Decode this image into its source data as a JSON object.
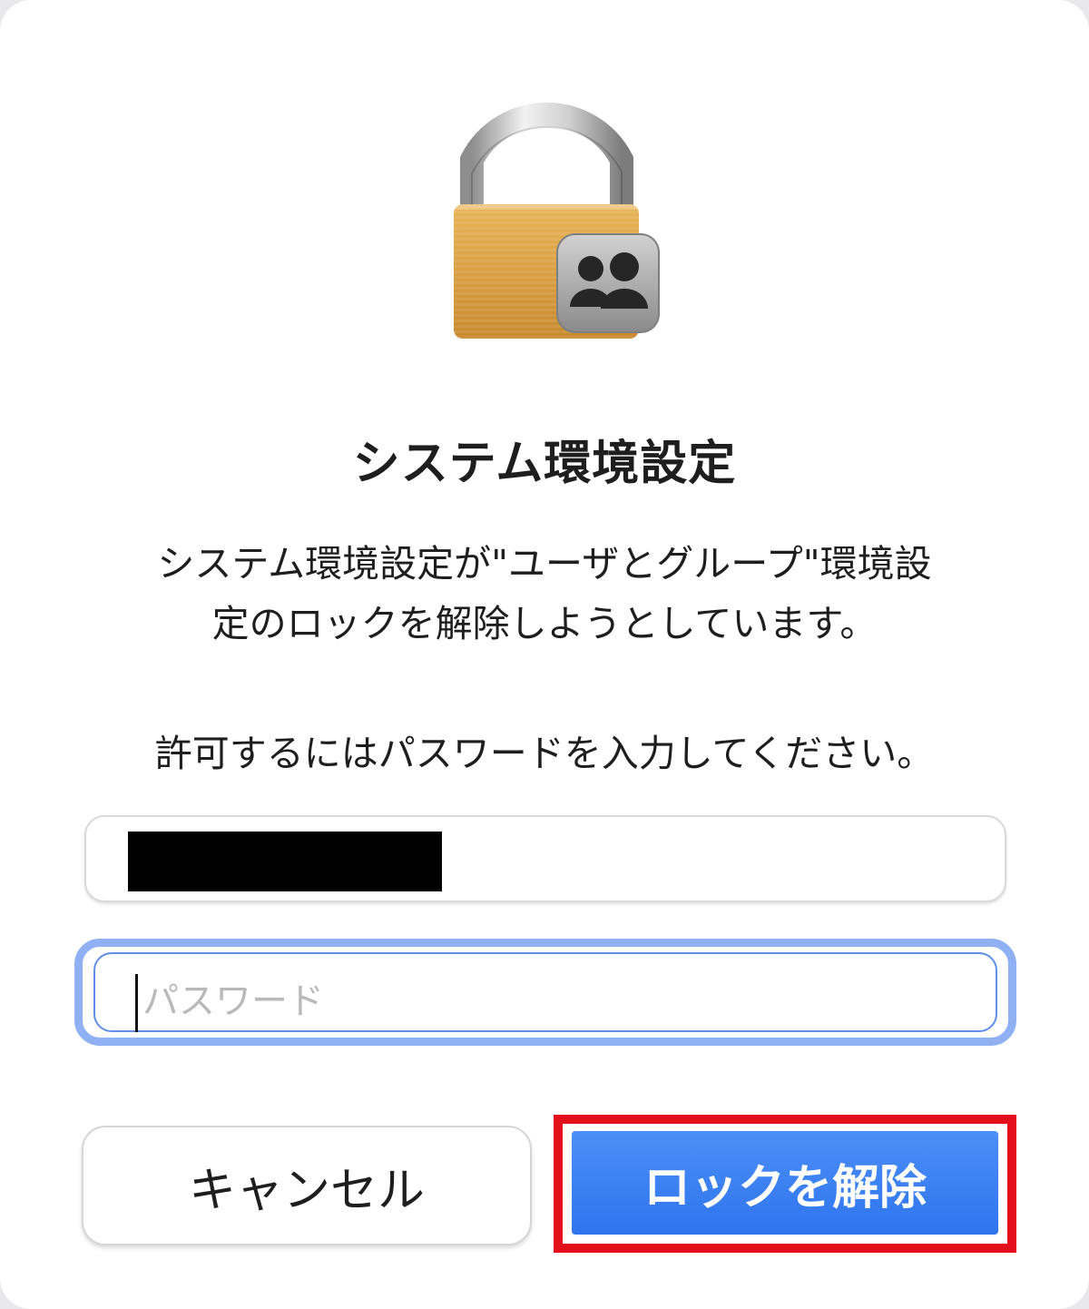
{
  "dialog": {
    "title": "システム環境設定",
    "message_line1": "システム環境設定が\"ユーザとグループ\"環境設",
    "message_line2": "定のロックを解除しようとしています。",
    "prompt": "許可するにはパスワードを入力してください。",
    "icon": "padlock-users-icon"
  },
  "fields": {
    "username": {
      "value_redacted": true
    },
    "password": {
      "placeholder": "パスワード",
      "value": ""
    }
  },
  "buttons": {
    "cancel_label": "キャンセル",
    "unlock_label": "ロックを解除"
  },
  "colors": {
    "accent": "#2f74ee",
    "focus_ring": "#8fb1f4",
    "highlight_annotation": "#e3101b"
  }
}
